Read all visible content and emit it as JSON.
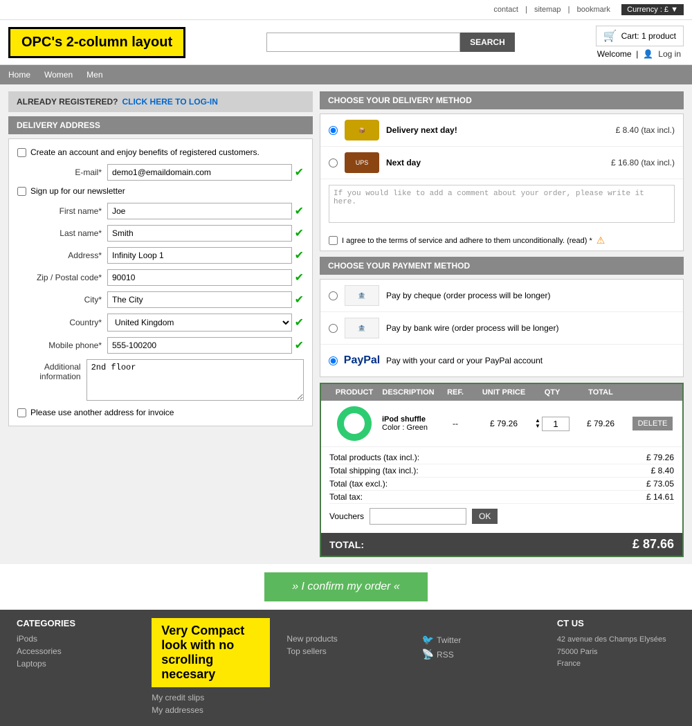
{
  "topbar": {
    "contact": "contact",
    "sitemap": "sitemap",
    "bookmark": "bookmark",
    "currency_label": "Currency : £ ▼"
  },
  "header": {
    "logo_text": "OPC's 2-column layout",
    "search_placeholder": "",
    "search_btn": "SEARCH",
    "cart_text": "Cart: 1 product",
    "welcome": "Welcome",
    "login": "Log in"
  },
  "left": {
    "already_reg_text": "ALREADY REGISTERED?",
    "login_link": "CLICK HERE TO LOG-IN",
    "delivery_address_title": "DELIVERY ADDRESS",
    "create_account_label": "Create an account and enjoy benefits of registered customers.",
    "email_label": "E-mail*",
    "email_value": "demo1@emaildomain.com",
    "newsletter_label": "Sign up for our newsletter",
    "firstname_label": "First name*",
    "firstname_value": "Joe",
    "lastname_label": "Last name*",
    "lastname_value": "Smith",
    "address_label": "Address*",
    "address_value": "Infinity Loop 1",
    "zip_label": "Zip / Postal code*",
    "zip_value": "90010",
    "city_label": "City*",
    "city_value": "The City",
    "country_label": "Country*",
    "country_value": "United Kingdom",
    "phone_label": "Mobile phone*",
    "phone_value": "555-100200",
    "additional_label": "Additional information",
    "additional_value": "2nd floor",
    "invoice_label": "Please use another address for invoice"
  },
  "delivery": {
    "section_title": "CHOOSE YOUR DELIVERY METHOD",
    "option1_label": "Delivery next day!",
    "option1_price": "£ 8.40 (tax incl.)",
    "option2_label": "Next day",
    "option2_price": "£ 16.80 (tax incl.)",
    "comment_placeholder": "If you would like to add a comment about your order, please write it here.",
    "terms_text": "I agree to the terms of service and adhere to them unconditionally. (read) *"
  },
  "payment": {
    "section_title": "CHOOSE YOUR PAYMENT METHOD",
    "option1_label": "Pay by cheque (order process will be longer)",
    "option2_label": "Pay by bank wire (order process will be longer)",
    "option3_label": "Pay with your card or your PayPal account"
  },
  "order_table": {
    "col_product": "PRODUCT",
    "col_description": "DESCRIPTION",
    "col_ref": "REF.",
    "col_unit_price": "UNIT PRICE",
    "col_qty": "QTY",
    "col_total": "TOTAL",
    "product_name": "iPod shuffle",
    "product_color": "Color : Green",
    "product_ref": "--",
    "product_unit_price": "£ 79.26",
    "product_qty": "1",
    "product_total": "£ 79.26",
    "delete_btn": "DELETE",
    "total_products_label": "Total products (tax incl.):",
    "total_products_value": "£ 79.26",
    "total_shipping_label": "Total shipping (tax incl.):",
    "total_shipping_value": "£ 8.40",
    "total_excl_label": "Total (tax excl.):",
    "total_excl_value": "£ 73.05",
    "total_tax_label": "Total tax:",
    "total_tax_value": "£ 14.61",
    "voucher_label": "Vouchers",
    "ok_btn": "OK",
    "grand_total_label": "TOTAL:",
    "grand_total_value": "£ 87.66"
  },
  "confirm": {
    "btn_text": "» I confirm my order «"
  },
  "footer": {
    "categories_title": "CATEGORIES",
    "ipods": "iPods",
    "accessories": "Accessories",
    "laptops": "Laptops",
    "compact_badge": "Very Compact look with no scrolling necesary",
    "my_credit_slips": "My credit slips",
    "my_addresses": "My addresses",
    "new_products": "New products",
    "top_sellers": "Top sellers",
    "contact_title": "CT US",
    "twitter": "Twitter",
    "rss": "RSS",
    "address_line1": "42 avenue des Champs Elysées",
    "address_line2": "75000 Paris",
    "address_line3": "France"
  }
}
